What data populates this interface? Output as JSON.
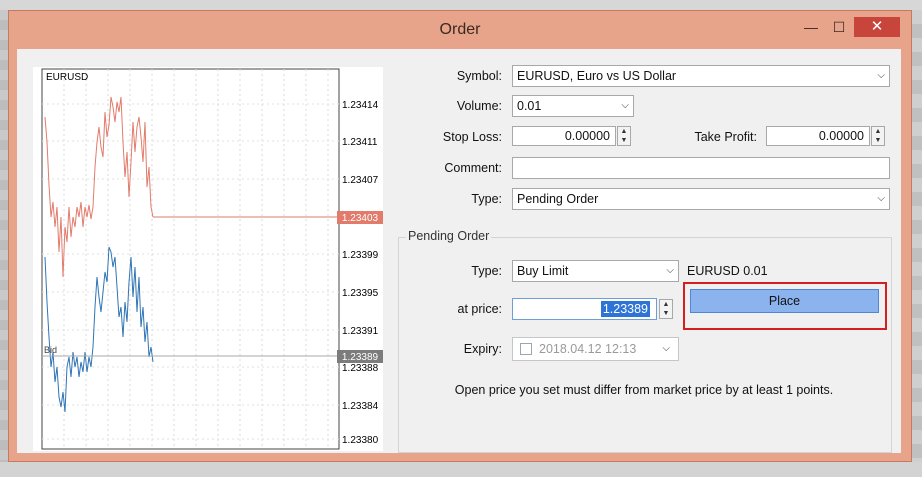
{
  "window": {
    "title": "Order",
    "min_glyph": "—",
    "max_glyph": "☐",
    "close_glyph": "✕"
  },
  "chart": {
    "symbol": "EURUSD",
    "price_labels": [
      "1.23414",
      "1.23411",
      "1.23407",
      "1.23403",
      "1.23399",
      "1.23395",
      "1.23391",
      "1.23389",
      "1.23388",
      "1.23384",
      "1.23380"
    ],
    "ask_badge": "1.23403",
    "bid_badge": "1.23389",
    "bid_line_label": "Bid",
    "ask_color": "#e27b6b",
    "bid_color": "#2f74b5"
  },
  "form": {
    "symbol_label": "Symbol:",
    "symbol_value": "EURUSD, Euro vs US Dollar",
    "volume_label": "Volume:",
    "volume_value": "0.01",
    "stoploss_label": "Stop Loss:",
    "stoploss_value": "0.00000",
    "takeprofit_label": "Take Profit:",
    "takeprofit_value": "0.00000",
    "comment_label": "Comment:",
    "comment_value": "",
    "type_label": "Type:",
    "type_value": "Pending Order"
  },
  "pending": {
    "group_title": "Pending Order",
    "type_label": "Type:",
    "type_value": "Buy Limit",
    "summary": "EURUSD 0.01",
    "price_label": "at price:",
    "price_value": "1.23389",
    "place_label": "Place",
    "expiry_label": "Expiry:",
    "expiry_value": "2018.04.12 12:13",
    "notice": "Open price you set must differ from market price by at least 1 points."
  },
  "accent": {
    "place_button": "#8bb3ee",
    "highlight": "#d31f1f",
    "close_button": "#c7453a"
  }
}
